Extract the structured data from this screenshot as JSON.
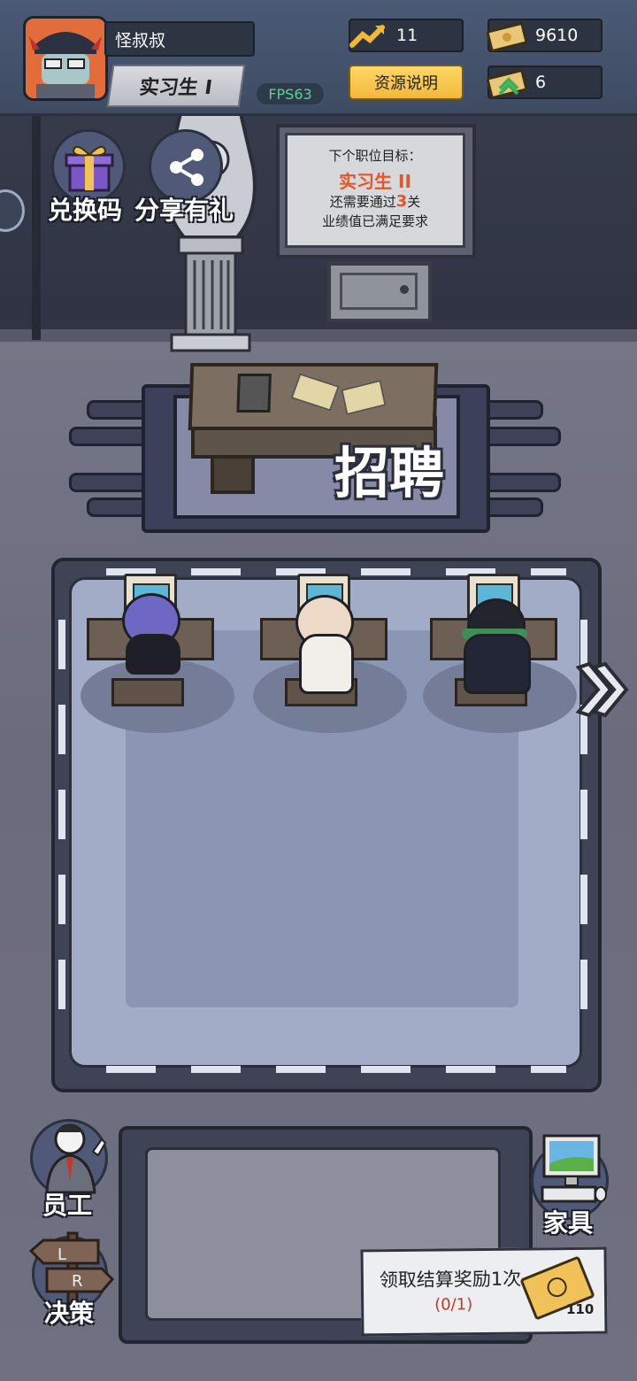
{
  "player": {
    "name": "怪叔叔",
    "rank": "实习生 I",
    "fps": "FPS63"
  },
  "resources": {
    "level": "11",
    "money": "9610",
    "gems": "6",
    "info_button": "资源说明"
  },
  "shortcuts": {
    "redeem": "兑换码",
    "share": "分享有礼"
  },
  "board": {
    "line1": "下个职位目标：",
    "target": "实习生 II",
    "line3_pre": "还需要通过",
    "line3_num": "3",
    "line3_post": "关",
    "line4": "业绩值已满足要求"
  },
  "recruit_label": "招聘",
  "bottom_nav": {
    "staff": "员工",
    "decision": "决策",
    "furniture": "家具"
  },
  "reward": {
    "title": "领取结算奖励1次",
    "count": "(0/1)",
    "ticket_value": "110"
  },
  "colors": {
    "accent_gold": "#f2b83b",
    "fps_green": "#5ad48c",
    "target_orange": "#e3552b",
    "count_red": "#c0392b"
  }
}
